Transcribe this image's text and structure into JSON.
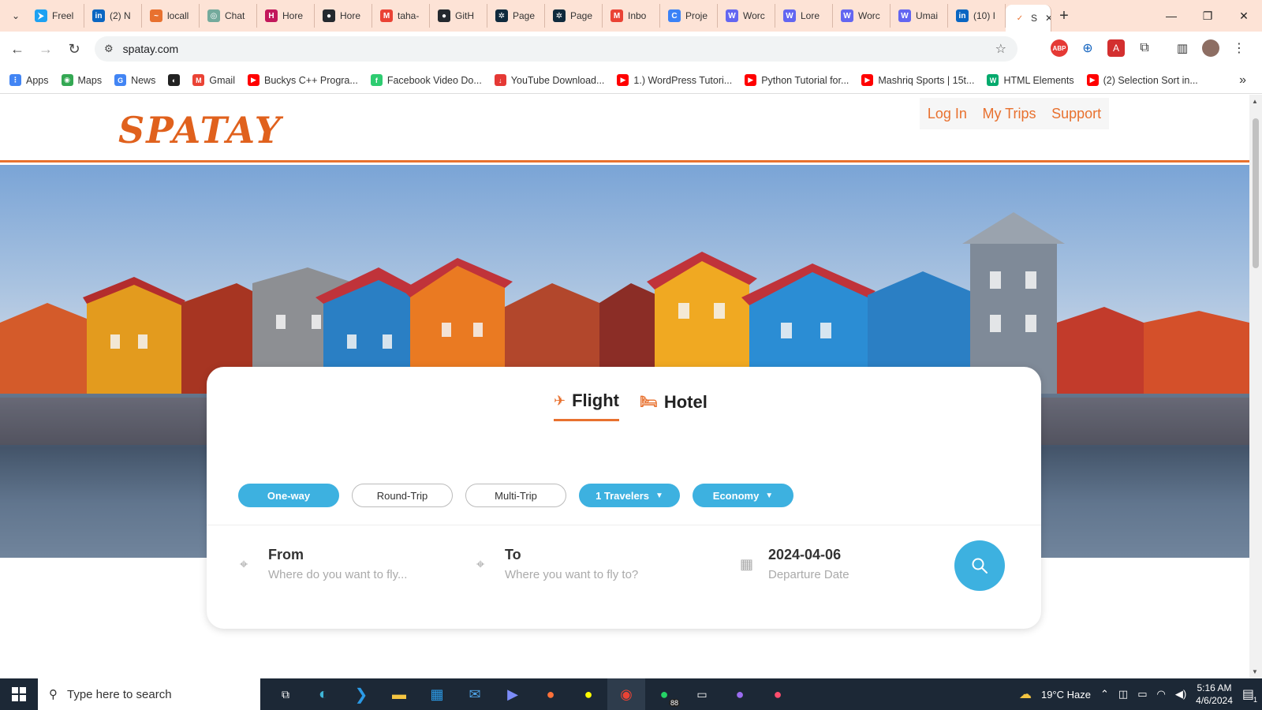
{
  "browser": {
    "tabs": [
      {
        "label": "Freel",
        "color": "#1da1f2",
        "glyph": "⮞"
      },
      {
        "label": "(2) N",
        "color": "#0a66c2",
        "glyph": "in"
      },
      {
        "label": "locall",
        "color": "#e8712f",
        "glyph": "~"
      },
      {
        "label": "Chat",
        "color": "#74aa9c",
        "glyph": "◎"
      },
      {
        "label": "Hore",
        "color": "#c2185b",
        "glyph": "H"
      },
      {
        "label": "Hore",
        "color": "#24292e",
        "glyph": "●"
      },
      {
        "label": "taha-",
        "color": "#ea4335",
        "glyph": "M"
      },
      {
        "label": "GitH",
        "color": "#24292e",
        "glyph": "●"
      },
      {
        "label": "Page",
        "color": "#0f2a3d",
        "glyph": "✲"
      },
      {
        "label": "Page",
        "color": "#0f2a3d",
        "glyph": "✲"
      },
      {
        "label": "Inbo",
        "color": "#ea4335",
        "glyph": "M"
      },
      {
        "label": "Proje",
        "color": "#3b82f6",
        "glyph": "C"
      },
      {
        "label": "Worc",
        "color": "#6366f1",
        "glyph": "W"
      },
      {
        "label": "Lore",
        "color": "#6366f1",
        "glyph": "W"
      },
      {
        "label": "Worc",
        "color": "#6366f1",
        "glyph": "W"
      },
      {
        "label": "Umai",
        "color": "#6366f1",
        "glyph": "W"
      },
      {
        "label": "(10) I",
        "color": "#0a66c2",
        "glyph": "in"
      }
    ],
    "active_tab": {
      "label": "S",
      "color": "#e8712f"
    },
    "url": "spatay.com",
    "bookmarks": [
      {
        "label": "Apps",
        "color": "#4285f4",
        "glyph": "⋮"
      },
      {
        "label": "Maps",
        "color": "#34a853",
        "glyph": "◉"
      },
      {
        "label": "News",
        "color": "#4285f4",
        "glyph": "G"
      },
      {
        "label": "",
        "color": "#222222",
        "glyph": "◐"
      },
      {
        "label": "Gmail",
        "color": "#ea4335",
        "glyph": "M"
      },
      {
        "label": "Buckys C++ Progra...",
        "color": "#ff0000",
        "glyph": "▶"
      },
      {
        "label": "Facebook Video Do...",
        "color": "#2ecc71",
        "glyph": "f"
      },
      {
        "label": "YouTube Download...",
        "color": "#e53935",
        "glyph": "↓"
      },
      {
        "label": "1.) WordPress Tutori...",
        "color": "#ff0000",
        "glyph": "▶"
      },
      {
        "label": "Python Tutorial for...",
        "color": "#ff0000",
        "glyph": "▶"
      },
      {
        "label": "Mashriq Sports | 15t...",
        "color": "#ff0000",
        "glyph": "▶"
      },
      {
        "label": "HTML Elements",
        "color": "#04aa6d",
        "glyph": "W"
      },
      {
        "label": "(2) Selection Sort in...",
        "color": "#ff0000",
        "glyph": "▶"
      }
    ]
  },
  "site": {
    "logo": "SPATAY",
    "nav": {
      "login": "Log In",
      "trips": "My Trips",
      "support": "Support"
    },
    "modes": {
      "flight": "Flight",
      "hotel": "Hotel"
    },
    "trip_types": {
      "oneway": "One-way",
      "round": "Round-Trip",
      "multi": "Multi-Trip"
    },
    "travelers": "1 Travelers",
    "cabin": "Economy",
    "from": {
      "label": "From",
      "placeholder": "Where do you want to fly..."
    },
    "to": {
      "label": "To",
      "placeholder": "Where you want to fly to?"
    },
    "date": {
      "value": "2024-04-06",
      "sub": "Departure Date"
    }
  },
  "taskbar": {
    "search_placeholder": "Type here to search",
    "weather": "19°C  Haze",
    "time": "5:16 AM",
    "date": "4/6/2024",
    "whatsapp_badge": "88",
    "notif_badge": "1"
  },
  "colors": {
    "accent": "#e8712f",
    "blue": "#3db1e0"
  }
}
